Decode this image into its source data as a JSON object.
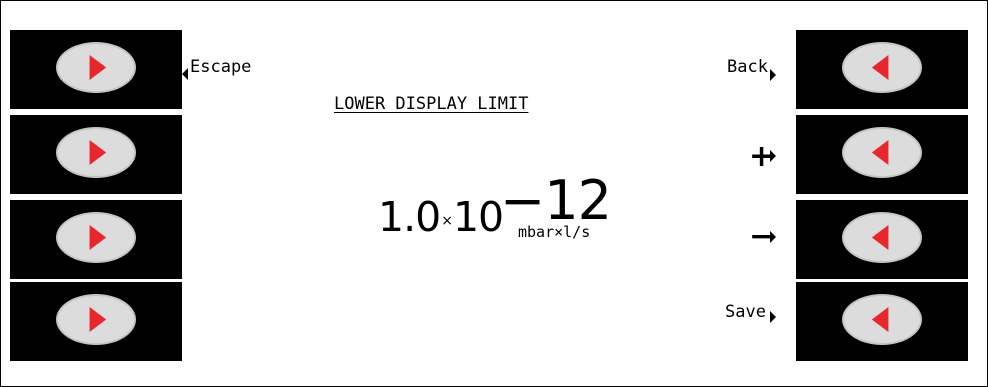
{
  "title": "LOWER DISPLAY LIMIT",
  "left_labels": {
    "escape": "Escape"
  },
  "right_labels": {
    "back": "Back",
    "plus": "+",
    "minus": "−",
    "save": "Save"
  },
  "value": {
    "mantissa": "1.0",
    "times": "×",
    "base": "10",
    "exponent": "−12",
    "unit": "mbar×l/s"
  },
  "colors": {
    "arrow": "#e8262d",
    "key_background": "#000000",
    "oval": "#dcdcdc"
  },
  "left_softkeys": [
    {
      "icon": "arrow-right-icon"
    },
    {
      "icon": "arrow-right-icon"
    },
    {
      "icon": "arrow-right-icon"
    },
    {
      "icon": "arrow-right-icon"
    }
  ],
  "right_softkeys": [
    {
      "icon": "arrow-left-icon"
    },
    {
      "icon": "arrow-left-icon"
    },
    {
      "icon": "arrow-left-icon"
    },
    {
      "icon": "arrow-left-icon"
    }
  ]
}
